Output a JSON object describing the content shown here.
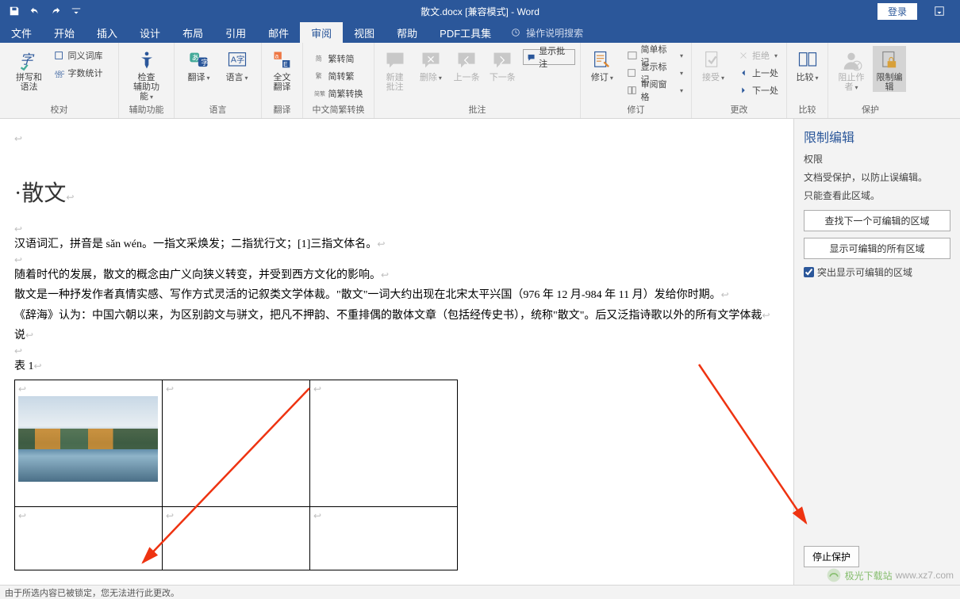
{
  "title": "散文.docx [兼容模式] - Word",
  "login": "登录",
  "tabs": [
    "文件",
    "开始",
    "插入",
    "设计",
    "布局",
    "引用",
    "邮件",
    "审阅",
    "视图",
    "帮助",
    "PDF工具集"
  ],
  "active_tab": "审阅",
  "tell_me": "操作说明搜索",
  "ribbon": {
    "proofing": {
      "label": "校对",
      "spell": "拼写和语法",
      "thesaurus": "同义词库",
      "wordcount": "字数统计"
    },
    "accessibility": {
      "label": "辅助功能",
      "check": "检查",
      "sub": "辅助功能"
    },
    "language": {
      "label": "语言",
      "translate": "翻译",
      "language": "语言"
    },
    "translate_full": {
      "label": "翻译",
      "full": "全文",
      "sub": "翻译"
    },
    "chinese": {
      "label": "中文简繁转换",
      "sc": "繁转简",
      "tc": "简转繁",
      "conv": "简繁转换"
    },
    "comments": {
      "label": "批注",
      "new": "新建",
      "new2": "批注",
      "delete": "删除",
      "prev": "上一条",
      "next": "下一条",
      "show": "显示批注"
    },
    "tracking": {
      "label": "修订",
      "track": "修订",
      "markup_mode": "简单标记",
      "show_markup": "显示标记",
      "review_pane": "审阅窗格"
    },
    "changes": {
      "label": "更改",
      "accept": "接受",
      "reject": "拒绝",
      "prev": "上一处",
      "next": "下一处"
    },
    "compare": {
      "label": "比较",
      "compare": "比较"
    },
    "protect": {
      "label": "保护",
      "block": "阻止作者",
      "restrict": "限制编辑"
    }
  },
  "pane": {
    "title": "限制编辑",
    "section": "权限",
    "line1": "文档受保护，以防止误编辑。",
    "line2": "只能查看此区域。",
    "btn1": "查找下一个可编辑的区域",
    "btn2": "显示可编辑的所有区域",
    "check": "突出显示可编辑的区域",
    "stop": "停止保护"
  },
  "doc": {
    "h1": "散文",
    "p1": "汉语词汇，拼音是 sǎn wén。一指文采焕发；二指犹行文；[1]三指文体名。",
    "p2": "随着时代的发展，散文的概念由广义向狭义转变，并受到西方文化的影响。",
    "p3": "散文是一种抒发作者真情实感、写作方式灵活的记叙类文学体裁。\"散文\"一词大约出现在北宋太平兴国（976 年 12 月-984 年 11 月）发给你时期。",
    "p4": "《辞海》认为：中国六朝以来，为区别韵文与骈文，把凡不押韵、不重排偶的散体文章（包括经传史书），统称\"散文\"。后又泛指诗歌以外的所有文学体裁",
    "p5": "说",
    "tablelabel": "表 1"
  },
  "status": "由于所选内容已被锁定，您无法进行此更改。",
  "watermark": {
    "brand": "极光下载站",
    "url": "www.xz7.com"
  }
}
